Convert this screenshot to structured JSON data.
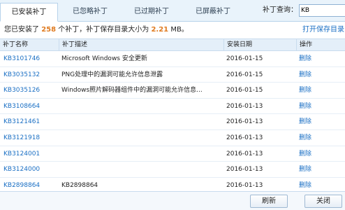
{
  "tabs": [
    {
      "label": "已安装补丁",
      "active": true
    },
    {
      "label": "已忽略补丁",
      "active": false
    },
    {
      "label": "已过期补丁",
      "active": false
    },
    {
      "label": "已屏蔽补丁",
      "active": false
    }
  ],
  "search": {
    "label": "补丁查询：",
    "value": "KB",
    "placeholder": ""
  },
  "summary": {
    "prefix": "您已安装了",
    "count": "258",
    "middle": "个补丁，补丁保存目录大小为",
    "size": "2.21",
    "unit": "MB。"
  },
  "open_dir_label": "打开保存目录",
  "table": {
    "headers": {
      "id": "补丁名称",
      "desc": "补丁描述",
      "date": "安装日期",
      "op": "操作"
    },
    "rows": [
      {
        "id": "KB3101746",
        "desc": "Microsoft Windows 安全更新",
        "date": "2016-01-15",
        "op": "删除"
      },
      {
        "id": "KB3035132",
        "desc": "PNG处理中的漏洞可能允许信息泄露",
        "date": "2016-01-15",
        "op": "删除"
      },
      {
        "id": "KB3035126",
        "desc": "Windows照片解码器组件中的漏洞可能允许信息...",
        "date": "2016-01-15",
        "op": "删除"
      },
      {
        "id": "KB3108664",
        "desc": "",
        "date": "2016-01-13",
        "op": "删除"
      },
      {
        "id": "KB3121461",
        "desc": "",
        "date": "2016-01-13",
        "op": "删除"
      },
      {
        "id": "KB3121918",
        "desc": "",
        "date": "2016-01-13",
        "op": "删除"
      },
      {
        "id": "KB3124001",
        "desc": "",
        "date": "2016-01-13",
        "op": "删除"
      },
      {
        "id": "KB3124000",
        "desc": "",
        "date": "2016-01-13",
        "op": "删除"
      },
      {
        "id": "KB2898864",
        "desc": "KB2898864",
        "date": "2016-01-13",
        "op": "删除"
      }
    ]
  },
  "footer": {
    "refresh_label": "刷新",
    "close_label": "关闭"
  }
}
